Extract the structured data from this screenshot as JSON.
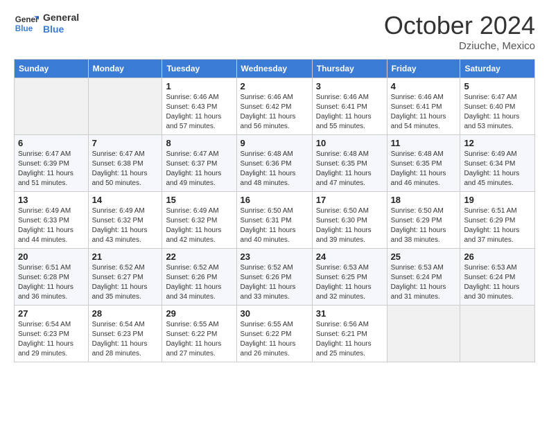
{
  "header": {
    "logo_general": "General",
    "logo_blue": "Blue",
    "month": "October 2024",
    "location": "Dziuche, Mexico"
  },
  "days_of_week": [
    "Sunday",
    "Monday",
    "Tuesday",
    "Wednesday",
    "Thursday",
    "Friday",
    "Saturday"
  ],
  "weeks": [
    [
      {
        "day": "",
        "info": ""
      },
      {
        "day": "",
        "info": ""
      },
      {
        "day": "1",
        "info": "Sunrise: 6:46 AM\nSunset: 6:43 PM\nDaylight: 11 hours and 57 minutes."
      },
      {
        "day": "2",
        "info": "Sunrise: 6:46 AM\nSunset: 6:42 PM\nDaylight: 11 hours and 56 minutes."
      },
      {
        "day": "3",
        "info": "Sunrise: 6:46 AM\nSunset: 6:41 PM\nDaylight: 11 hours and 55 minutes."
      },
      {
        "day": "4",
        "info": "Sunrise: 6:46 AM\nSunset: 6:41 PM\nDaylight: 11 hours and 54 minutes."
      },
      {
        "day": "5",
        "info": "Sunrise: 6:47 AM\nSunset: 6:40 PM\nDaylight: 11 hours and 53 minutes."
      }
    ],
    [
      {
        "day": "6",
        "info": "Sunrise: 6:47 AM\nSunset: 6:39 PM\nDaylight: 11 hours and 51 minutes."
      },
      {
        "day": "7",
        "info": "Sunrise: 6:47 AM\nSunset: 6:38 PM\nDaylight: 11 hours and 50 minutes."
      },
      {
        "day": "8",
        "info": "Sunrise: 6:47 AM\nSunset: 6:37 PM\nDaylight: 11 hours and 49 minutes."
      },
      {
        "day": "9",
        "info": "Sunrise: 6:48 AM\nSunset: 6:36 PM\nDaylight: 11 hours and 48 minutes."
      },
      {
        "day": "10",
        "info": "Sunrise: 6:48 AM\nSunset: 6:35 PM\nDaylight: 11 hours and 47 minutes."
      },
      {
        "day": "11",
        "info": "Sunrise: 6:48 AM\nSunset: 6:35 PM\nDaylight: 11 hours and 46 minutes."
      },
      {
        "day": "12",
        "info": "Sunrise: 6:49 AM\nSunset: 6:34 PM\nDaylight: 11 hours and 45 minutes."
      }
    ],
    [
      {
        "day": "13",
        "info": "Sunrise: 6:49 AM\nSunset: 6:33 PM\nDaylight: 11 hours and 44 minutes."
      },
      {
        "day": "14",
        "info": "Sunrise: 6:49 AM\nSunset: 6:32 PM\nDaylight: 11 hours and 43 minutes."
      },
      {
        "day": "15",
        "info": "Sunrise: 6:49 AM\nSunset: 6:32 PM\nDaylight: 11 hours and 42 minutes."
      },
      {
        "day": "16",
        "info": "Sunrise: 6:50 AM\nSunset: 6:31 PM\nDaylight: 11 hours and 40 minutes."
      },
      {
        "day": "17",
        "info": "Sunrise: 6:50 AM\nSunset: 6:30 PM\nDaylight: 11 hours and 39 minutes."
      },
      {
        "day": "18",
        "info": "Sunrise: 6:50 AM\nSunset: 6:29 PM\nDaylight: 11 hours and 38 minutes."
      },
      {
        "day": "19",
        "info": "Sunrise: 6:51 AM\nSunset: 6:29 PM\nDaylight: 11 hours and 37 minutes."
      }
    ],
    [
      {
        "day": "20",
        "info": "Sunrise: 6:51 AM\nSunset: 6:28 PM\nDaylight: 11 hours and 36 minutes."
      },
      {
        "day": "21",
        "info": "Sunrise: 6:52 AM\nSunset: 6:27 PM\nDaylight: 11 hours and 35 minutes."
      },
      {
        "day": "22",
        "info": "Sunrise: 6:52 AM\nSunset: 6:26 PM\nDaylight: 11 hours and 34 minutes."
      },
      {
        "day": "23",
        "info": "Sunrise: 6:52 AM\nSunset: 6:26 PM\nDaylight: 11 hours and 33 minutes."
      },
      {
        "day": "24",
        "info": "Sunrise: 6:53 AM\nSunset: 6:25 PM\nDaylight: 11 hours and 32 minutes."
      },
      {
        "day": "25",
        "info": "Sunrise: 6:53 AM\nSunset: 6:24 PM\nDaylight: 11 hours and 31 minutes."
      },
      {
        "day": "26",
        "info": "Sunrise: 6:53 AM\nSunset: 6:24 PM\nDaylight: 11 hours and 30 minutes."
      }
    ],
    [
      {
        "day": "27",
        "info": "Sunrise: 6:54 AM\nSunset: 6:23 PM\nDaylight: 11 hours and 29 minutes."
      },
      {
        "day": "28",
        "info": "Sunrise: 6:54 AM\nSunset: 6:23 PM\nDaylight: 11 hours and 28 minutes."
      },
      {
        "day": "29",
        "info": "Sunrise: 6:55 AM\nSunset: 6:22 PM\nDaylight: 11 hours and 27 minutes."
      },
      {
        "day": "30",
        "info": "Sunrise: 6:55 AM\nSunset: 6:22 PM\nDaylight: 11 hours and 26 minutes."
      },
      {
        "day": "31",
        "info": "Sunrise: 6:56 AM\nSunset: 6:21 PM\nDaylight: 11 hours and 25 minutes."
      },
      {
        "day": "",
        "info": ""
      },
      {
        "day": "",
        "info": ""
      }
    ]
  ]
}
